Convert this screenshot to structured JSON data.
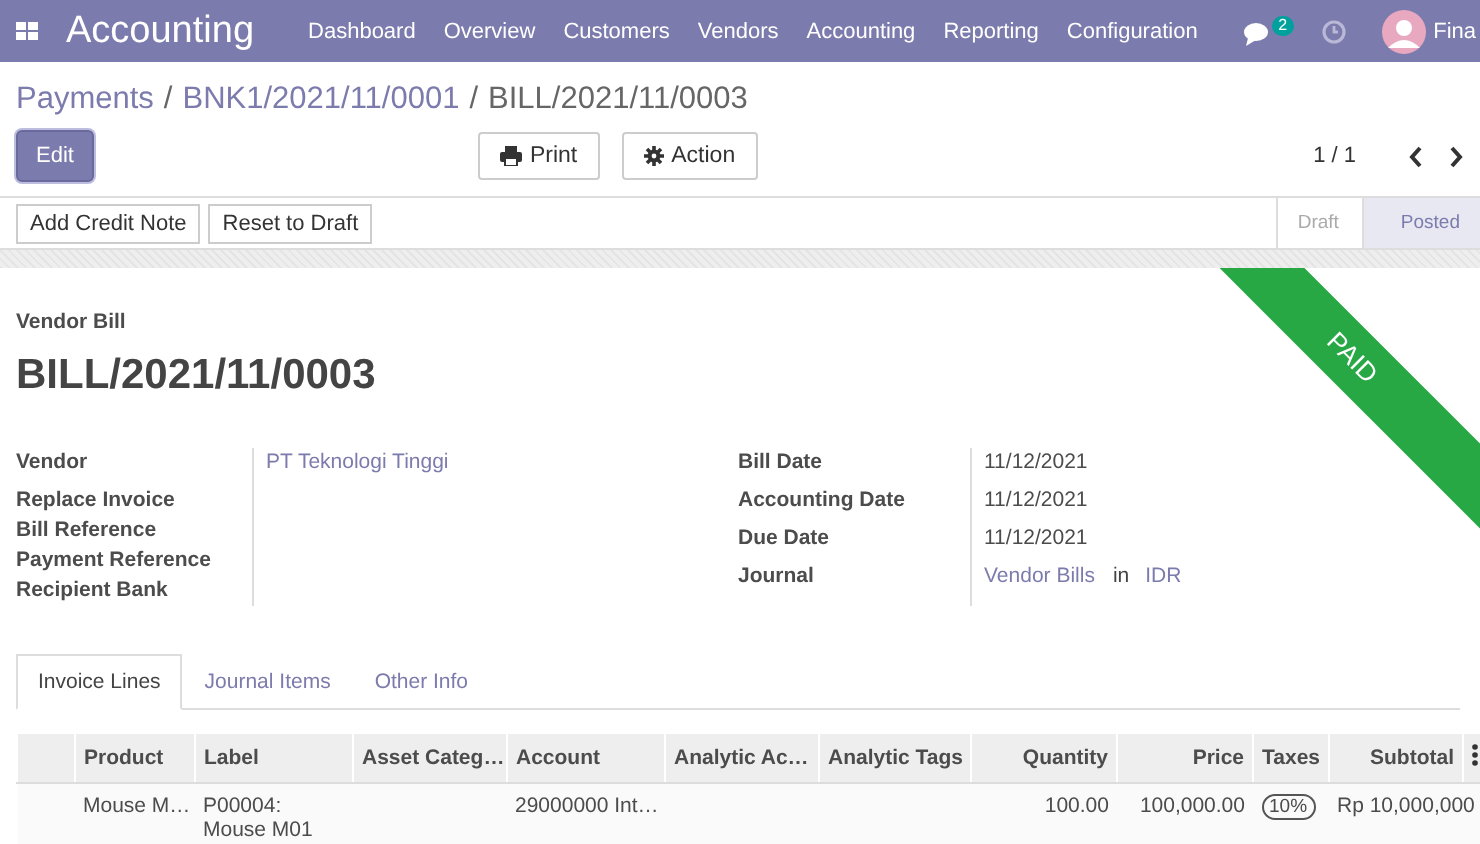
{
  "navbar": {
    "app_title": "Accounting",
    "menu": [
      "Dashboard",
      "Overview",
      "Customers",
      "Vendors",
      "Accounting",
      "Reporting",
      "Configuration"
    ],
    "messages_count": "2",
    "user_name": "Fina"
  },
  "breadcrumb": [
    {
      "label": "Payments",
      "kind": "link"
    },
    {
      "label": "/",
      "kind": "separator"
    },
    {
      "label": "BNK1/2021/11/0001",
      "kind": "link"
    },
    {
      "label": "/",
      "kind": "separator"
    },
    {
      "label": "BILL/2021/11/0003",
      "kind": "current"
    }
  ],
  "control_panel": {
    "edit_button": "Edit",
    "print_button": "Print",
    "action_button": "Action",
    "pager": "1 / 1"
  },
  "status_bar": {
    "buttons": [
      "Add Credit Note",
      "Reset to Draft"
    ],
    "stages": [
      {
        "label": "Draft",
        "selected": false
      },
      {
        "label": "Posted",
        "selected": true
      }
    ]
  },
  "form": {
    "type_label": "Vendor Bill",
    "title": "BILL/2021/11/0003",
    "ribbon": "PAID",
    "left_fields": [
      {
        "label": "Vendor",
        "value": "PT Teknologi Tinggi"
      },
      {
        "label": "Replace Invoice"
      },
      {
        "label": "Bill Reference"
      },
      {
        "label": "Payment Reference"
      },
      {
        "label": "Recipient Bank"
      }
    ],
    "right_fields": [
      {
        "label": "Bill Date",
        "value": "11/12/2021"
      },
      {
        "label": "Accounting Date",
        "value": "11/12/2021"
      },
      {
        "label": "Due Date",
        "value": "11/12/2021"
      },
      {
        "label": "Journal",
        "journal": "Vendor Bills",
        "joiner": "in",
        "currency": "IDR"
      }
    ]
  },
  "tabs": [
    {
      "label": "Invoice Lines",
      "selected": true
    },
    {
      "label": "Journal Items",
      "selected": false
    },
    {
      "label": "Other Info",
      "selected": false
    }
  ],
  "table": {
    "columns": [
      "Product",
      "Label",
      "Asset Categ…",
      "Account",
      "Analytic Ac…",
      "Analytic Tags",
      "Quantity",
      "Price",
      "Taxes",
      "Subtotal"
    ],
    "rows": [
      {
        "cells": [
          "Mouse M…",
          "P00004:\nMouse M01",
          "",
          "29000000 Int…",
          "",
          "",
          "100.00",
          "100,000.00",
          "10%",
          "Rp 10,000,000"
        ]
      }
    ]
  }
}
